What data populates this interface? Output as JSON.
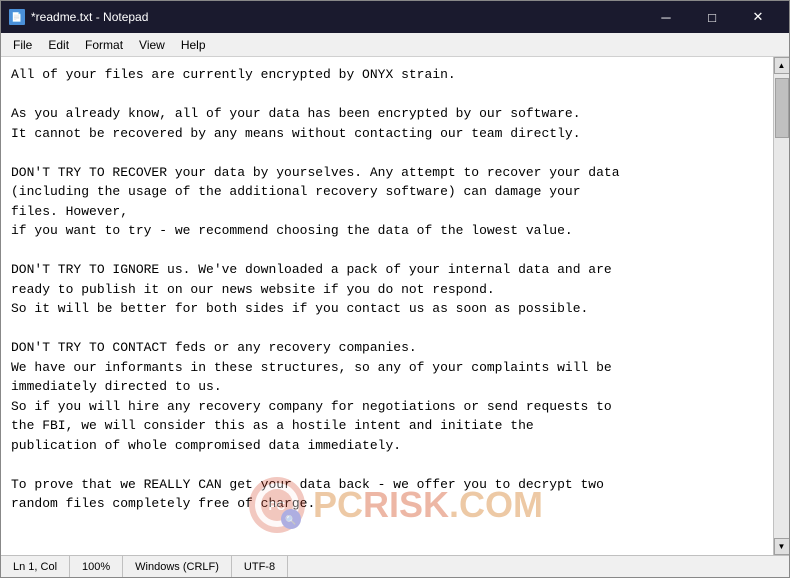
{
  "window": {
    "title": "*readme.txt - Notepad",
    "icon": "📄"
  },
  "titlebar_buttons": {
    "minimize": "─",
    "maximize": "□",
    "close": "✕"
  },
  "menu": {
    "items": [
      "File",
      "Edit",
      "Format",
      "View",
      "Help"
    ]
  },
  "content": {
    "text": "All of your files are currently encrypted by ONYX strain.\n\nAs you already know, all of your data has been encrypted by our software.\nIt cannot be recovered by any means without contacting our team directly.\n\nDON'T TRY TO RECOVER your data by yourselves. Any attempt to recover your data\n(including the usage of the additional recovery software) can damage your\nfiles. However,\nif you want to try - we recommend choosing the data of the lowest value.\n\nDON'T TRY TO IGNORE us. We've downloaded a pack of your internal data and are\nready to publish it on our news website if you do not respond.\nSo it will be better for both sides if you contact us as soon as possible.\n\nDON'T TRY TO CONTACT feds or any recovery companies.\nWe have our informants in these structures, so any of your complaints will be\nimmediately directed to us.\nSo if you will hire any recovery company for negotiations or send requests to\nthe FBI, we will consider this as a hostile intent and initiate the\npublication of whole compromised data immediately.\n\nTo prove that we REALLY CAN get your data back - we offer you to decrypt two\nrandom files completely free of charge."
  },
  "status_bar": {
    "position": "Ln 1, Col",
    "zoom": "100%",
    "line_ending": "Windows (CRLF)",
    "encoding": "UTF-8"
  },
  "watermark": {
    "text": "PC",
    "site": "RISK.COM"
  }
}
